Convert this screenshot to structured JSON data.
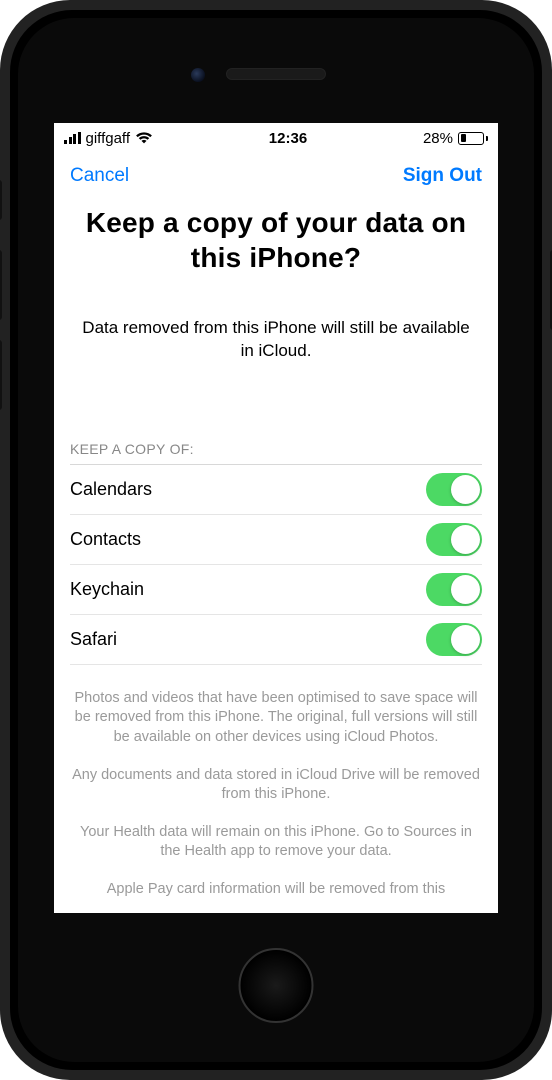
{
  "status": {
    "carrier": "giffgaff",
    "time": "12:36",
    "battery_pct": "28%"
  },
  "nav": {
    "cancel": "Cancel",
    "signout": "Sign Out"
  },
  "title": "Keep a copy of your data on this iPhone?",
  "subtitle": "Data removed from this iPhone will still be available in iCloud.",
  "section_header": "KEEP A COPY OF:",
  "items": [
    {
      "label": "Calendars",
      "on": true
    },
    {
      "label": "Contacts",
      "on": true
    },
    {
      "label": "Keychain",
      "on": true
    },
    {
      "label": "Safari",
      "on": true
    }
  ],
  "footer": {
    "p1": "Photos and videos that have been optimised to save space will be removed from this iPhone. The original, full versions will still be available on other devices using iCloud Photos.",
    "p2": "Any documents and data stored in iCloud Drive will be removed from this iPhone.",
    "p3": "Your Health data will remain on this iPhone. Go to Sources in the Health app to remove your data.",
    "p4": "Apple Pay card information will be removed from this"
  }
}
